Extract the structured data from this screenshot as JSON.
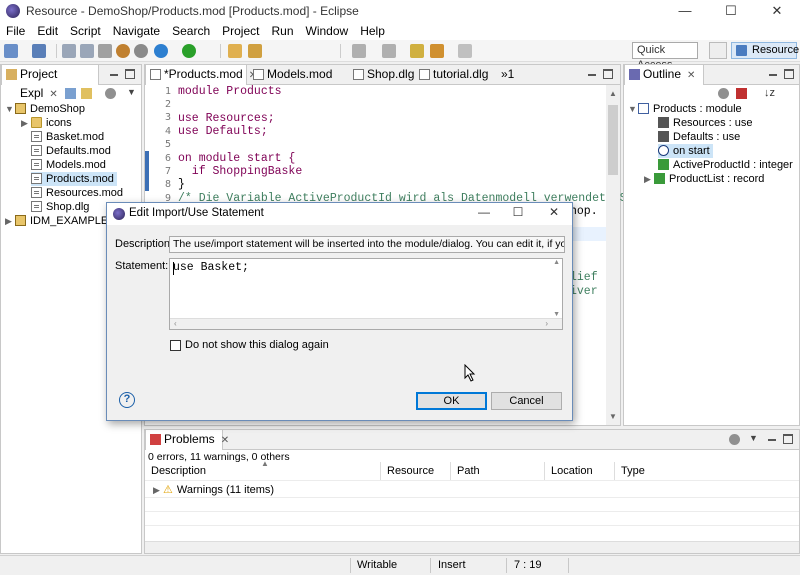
{
  "window": {
    "title": "Resource - DemoShop/Products.mod [Products.mod] - Eclipse",
    "min_glyph": "—",
    "max_glyph": "☐",
    "close_glyph": "✕"
  },
  "menu": [
    "File",
    "Edit",
    "Script",
    "Navigate",
    "Search",
    "Project",
    "Run",
    "Window",
    "Help"
  ],
  "toolbar": {
    "quick_access": "Quick Access",
    "perspective": "Resource"
  },
  "project_explorer": {
    "tab_label": "Project Expl",
    "items": [
      {
        "label": "DemoShop",
        "depth": 0,
        "kind": "project",
        "expanded": true
      },
      {
        "label": "icons",
        "depth": 1,
        "kind": "folder",
        "expanded": false
      },
      {
        "label": "Basket.mod",
        "depth": 1,
        "kind": "file"
      },
      {
        "label": "Defaults.mod",
        "depth": 1,
        "kind": "file"
      },
      {
        "label": "Models.mod",
        "depth": 1,
        "kind": "file"
      },
      {
        "label": "Products.mod",
        "depth": 1,
        "kind": "file",
        "selected": true
      },
      {
        "label": "Resources.mod",
        "depth": 1,
        "kind": "file"
      },
      {
        "label": "Shop.dlg",
        "depth": 1,
        "kind": "file"
      },
      {
        "label": "IDM_EXAMPLES",
        "depth": 0,
        "kind": "project",
        "expanded": false
      }
    ]
  },
  "editor": {
    "tabs": [
      {
        "label": "*Products.mod",
        "active": true
      },
      {
        "label": "Models.mod"
      },
      {
        "label": "Shop.dlg"
      },
      {
        "label": "tutorial.dlg"
      }
    ],
    "overflow_tab": "»1",
    "lines": [
      {
        "n": "1",
        "text": "module Products"
      },
      {
        "n": "2",
        "text": ""
      },
      {
        "n": "3",
        "text": "use Resources;"
      },
      {
        "n": "4",
        "text": "use Defaults;"
      },
      {
        "n": "5",
        "text": ""
      },
      {
        "n": "6",
        "text": "on module start {"
      },
      {
        "n": "7",
        "text": "  if ShoppingBaske"
      },
      {
        "n": "8",
        "text": "}"
      },
      {
        "n": "9",
        "text": "/* Die Variable ActiveProductId wird als Datenmodell verwendet. Sie"
      }
    ],
    "partial_texts": [
      "hop.",
      "lief",
      "iver"
    ]
  },
  "outline": {
    "tab_label": "Outline",
    "items": [
      {
        "label": "Products : module",
        "depth": 0
      },
      {
        "label": "Resources : use",
        "depth": 1
      },
      {
        "label": "Defaults : use",
        "depth": 1
      },
      {
        "label": "on start",
        "depth": 1,
        "selected": true
      },
      {
        "label": "ActiveProductId : integer",
        "depth": 1
      },
      {
        "label": "ProductList : record",
        "depth": 1
      }
    ]
  },
  "problems": {
    "tab_label": "Problems",
    "summary": "0 errors, 11 warnings, 0 others",
    "columns": [
      "Description",
      "Resource",
      "Path",
      "Location",
      "Type"
    ],
    "rows": [
      {
        "label": "Warnings (11 items)"
      }
    ]
  },
  "statusbar": {
    "writable": "Writable",
    "insert": "Insert",
    "position": "7 : 19"
  },
  "dialog": {
    "title": "Edit Import/Use Statement",
    "description_label": "Description:",
    "description_text": "The use/import statement will be inserted into the module/dialog. You can edit it, if you want.",
    "statement_label": "Statement:",
    "statement_value": "use Basket;",
    "checkbox_label": "Do not show this dialog again",
    "checkbox_checked": false,
    "ok_label": "OK",
    "cancel_label": "Cancel",
    "help_glyph": "?"
  }
}
